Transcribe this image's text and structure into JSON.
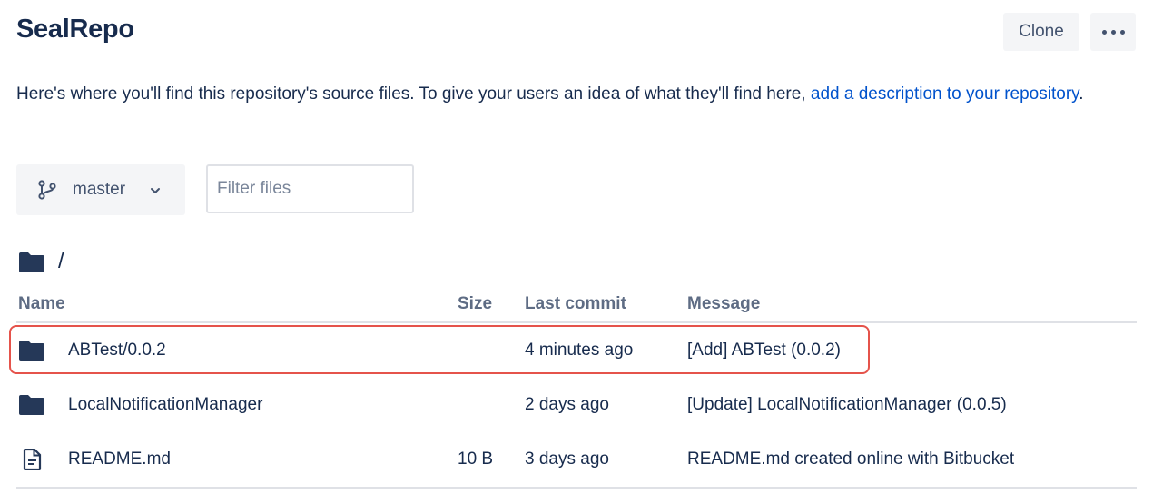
{
  "header": {
    "repo_name": "SealRepo",
    "clone_label": "Clone",
    "more_icon": "more-horizontal-icon"
  },
  "description": {
    "text": "Here's where you'll find this repository's source files. To give your users an idea of what they'll find here, ",
    "link_text": "add a description to your repository",
    "suffix": "."
  },
  "branch": {
    "icon": "branch-icon",
    "name": "master"
  },
  "filter": {
    "placeholder": "Filter files",
    "value": ""
  },
  "path": {
    "icon": "folder-icon",
    "current": "/"
  },
  "table": {
    "columns": {
      "name": "Name",
      "size": "Size",
      "last_commit": "Last commit",
      "message": "Message"
    },
    "rows": [
      {
        "type": "folder",
        "icon": "folder-icon",
        "name": "ABTest/0.0.2",
        "size": "",
        "last_commit": "4 minutes ago",
        "message": "[Add] ABTest (0.0.2)",
        "highlighted": true
      },
      {
        "type": "folder",
        "icon": "folder-icon",
        "name": "LocalNotificationManager",
        "size": "",
        "last_commit": "2 days ago",
        "message": "[Update] LocalNotificationManager (0.0.5)",
        "highlighted": false
      },
      {
        "type": "file",
        "icon": "file-icon",
        "name": "README.md",
        "size": "10 B",
        "last_commit": "3 days ago",
        "message": "README.md created online with Bitbucket",
        "highlighted": false
      }
    ]
  },
  "colors": {
    "text": "#172b4d",
    "muted": "#5e6c84",
    "link": "#0052cc",
    "button_bg": "#f4f5f7",
    "highlight": "#e5534b",
    "icon": "#253858"
  }
}
